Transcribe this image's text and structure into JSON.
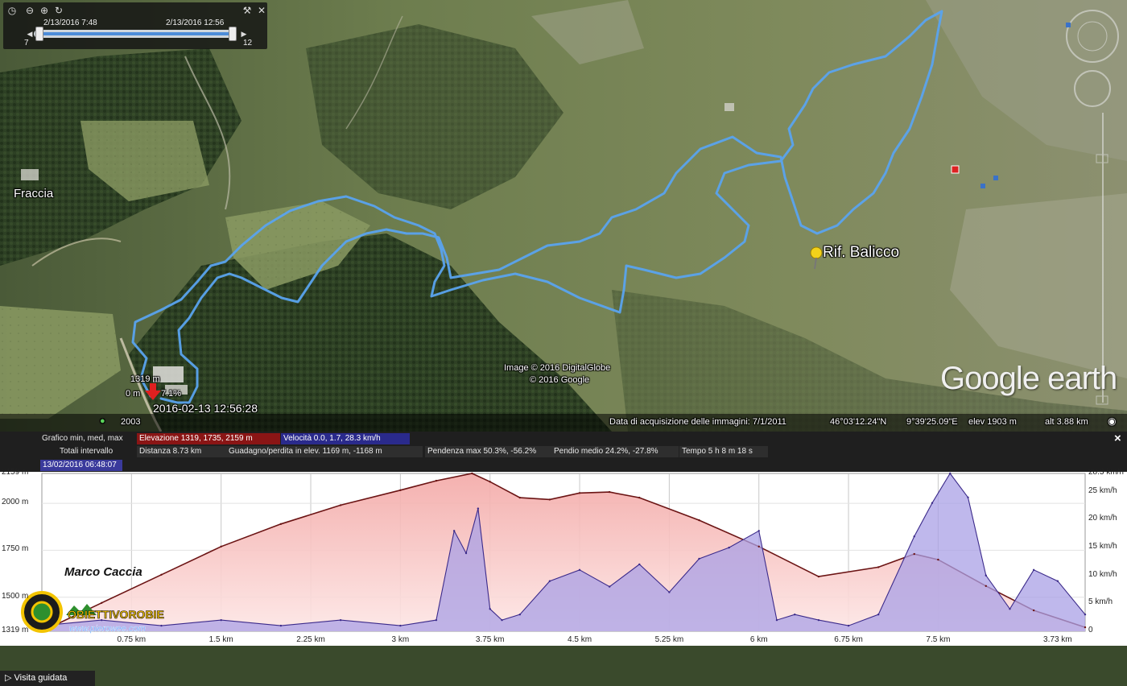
{
  "time_slider": {
    "start_label": "2/13/2016   7:48",
    "end_label": "2/13/2016  12:56",
    "min_label": "7",
    "max_label": "12"
  },
  "map": {
    "places": [
      {
        "name": "Fraccia"
      },
      {
        "name": "Rif. Balicco"
      }
    ],
    "marker": {
      "elevation": "1319 m",
      "distance": "0 m",
      "slope": "7.1%",
      "timestamp": "2016-02-13 12:56:28"
    },
    "year": "2003",
    "attribution_1": "Image © 2016 DigitalGlobe",
    "attribution_2": "© 2016 Google",
    "brand": "Google earth",
    "status": {
      "acquisition": "Data di acquisizione delle immagini: 7/1/2011",
      "lat": "46°03'12.24\"N",
      "lon": "9°39'25.09\"E",
      "elev": "elev   1903 m",
      "alt": "alt   3.88 km"
    },
    "colors": {
      "track": "#5aa3ee",
      "marker": "#e02020",
      "pin": "#f2d21a"
    }
  },
  "profile": {
    "header": {
      "grafico": "Grafico  min, med, max",
      "elevazione": "Elevazione  1319, 1735, 2159 m",
      "velocita": "Velocità  0.0, 1.7, 28.3 km/h",
      "totali": "Totali intervallo",
      "distanza": "Distanza  8.73 km",
      "guadagno": "Guadagno/perdita in elev.  1169 m, -1168 m",
      "pendenza": "Pendenza max  50.3%, -56.2%",
      "pendio": "Pendio medio  24.2%, -27.8%",
      "tempo": "Tempo  5 h 8 m 18 s",
      "cursor_time": "13/02/2016 06:48:07",
      "close": "×"
    },
    "y_left_labels": [
      "2159 m",
      "2000 m",
      "1750 m",
      "1500 m",
      "1319 m"
    ],
    "y_right_labels": [
      "28.3 km/h",
      "25 km/h",
      "20 km/h",
      "15 km/h",
      "10 km/h",
      "5 km/h",
      "0"
    ],
    "x_labels": [
      "0.75 km",
      "1.5 km",
      "2.25 km",
      "3 km",
      "3.75 km",
      "4.5 km",
      "5.25 km",
      "6 km",
      "6.75 km",
      "7.5 km",
      "3.73 km"
    ],
    "author": "Marco Caccia",
    "logo_text": "OBIETTIVOROBIE",
    "logo_sub": "www.pierowee.com",
    "guided_tour": "Visita guidata",
    "colors": {
      "elevation_fill": "#f8c4c2",
      "elevation_line": "#6b1414",
      "speed_fill": "#a9a0e6",
      "speed_line": "#3b2a8a"
    }
  },
  "chart_data": {
    "type": "area",
    "xlabel": "",
    "ylabel": "",
    "x_unit": "km",
    "series": [
      {
        "name": "Elevazione",
        "unit": "m",
        "x": [
          0,
          0.5,
          1.0,
          1.5,
          2.0,
          2.5,
          3.0,
          3.3,
          3.6,
          3.75,
          4.0,
          4.25,
          4.5,
          4.75,
          5.0,
          5.5,
          6.0,
          6.5,
          7.0,
          7.3,
          7.5,
          7.9,
          8.3,
          8.73
        ],
        "values": [
          1319,
          1470,
          1620,
          1770,
          1890,
          1990,
          2070,
          2120,
          2159,
          2115,
          2030,
          2020,
          2055,
          2060,
          2030,
          1910,
          1770,
          1610,
          1660,
          1730,
          1700,
          1560,
          1430,
          1340
        ]
      },
      {
        "name": "Velocità",
        "unit": "km/h",
        "x": [
          0,
          0.5,
          1.0,
          1.5,
          2.0,
          2.5,
          3.0,
          3.3,
          3.45,
          3.55,
          3.65,
          3.75,
          3.85,
          4.0,
          4.25,
          4.5,
          4.75,
          5.0,
          5.25,
          5.5,
          5.75,
          6.0,
          6.15,
          6.3,
          6.5,
          6.75,
          7.0,
          7.3,
          7.45,
          7.6,
          7.75,
          7.9,
          8.1,
          8.3,
          8.5,
          8.73
        ],
        "values": [
          1,
          2,
          1,
          2,
          1,
          2,
          1,
          2,
          18,
          14,
          22,
          4,
          2,
          3,
          9,
          11,
          8,
          12,
          7,
          13,
          15,
          18,
          2,
          3,
          2,
          1,
          3,
          17,
          23,
          28.3,
          24,
          10,
          4,
          11,
          9,
          3
        ]
      }
    ],
    "ylim_left": [
      1319,
      2159
    ],
    "ylim_right": [
      0,
      28.3
    ],
    "grid": true
  }
}
